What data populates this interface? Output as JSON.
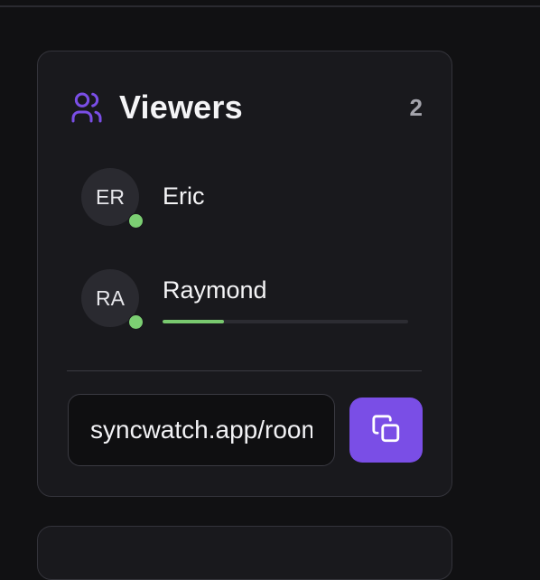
{
  "viewers_panel": {
    "title": "Viewers",
    "count": "2",
    "title_icon": "users-icon",
    "accent_color": "#7a4ee6",
    "online_color": "#7ccf73",
    "viewers": [
      {
        "initials": "ER",
        "name": "Eric",
        "online": true
      },
      {
        "initials": "RA",
        "name": "Raymond",
        "online": true,
        "progress_percent": 25
      }
    ],
    "share": {
      "link_value": "syncwatch.app/room",
      "copy_icon": "copy-icon"
    }
  }
}
